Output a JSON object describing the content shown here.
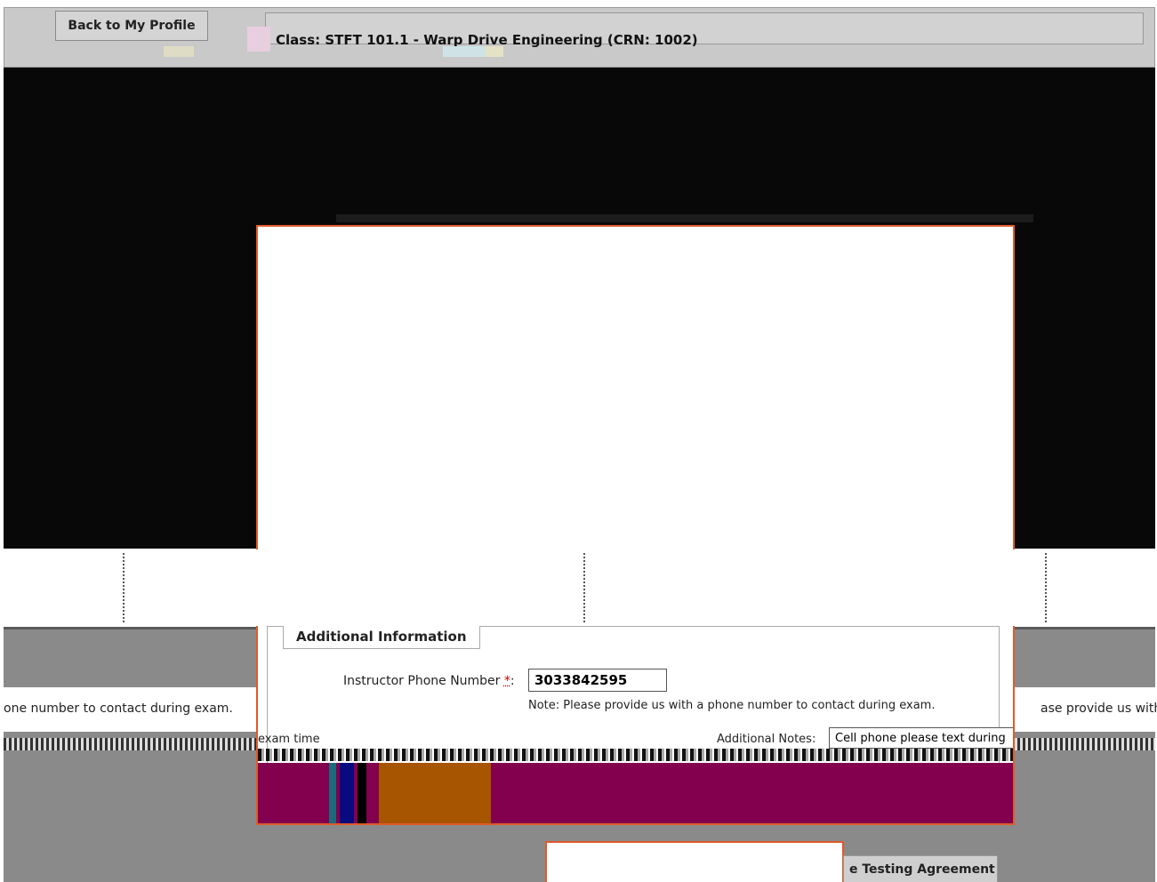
{
  "header": {
    "back_button_label": "Back to My Profile",
    "class_title": "Class: STFT 101.1 - Warp Drive Engineering    (CRN: 1002)"
  },
  "form": {
    "section_legend": "Additional Information",
    "phone_label": "Instructor Phone Number ",
    "phone_required_marker": "*",
    "phone_label_suffix": ":",
    "phone_value": "3033842595",
    "phone_note": "Note: Please provide us with a phone number to contact during exam.",
    "additional_notes_label": "Additional Notes:",
    "additional_notes_value": "Cell phone please text during",
    "exam_time_label": "exam time"
  },
  "background": {
    "left_note": "one number to contact during exam.",
    "right_note": "ase provide us with a p"
  },
  "footer": {
    "agreement_button_label": "e Testing Agreement"
  },
  "colors": {
    "modal_border": "#e05a2b",
    "footer_bar": "#82004e",
    "footer_accent_orange": "#a85500",
    "footer_accent_navy": "#0a0a80",
    "footer_accent_teal": "#1c6a7a"
  }
}
